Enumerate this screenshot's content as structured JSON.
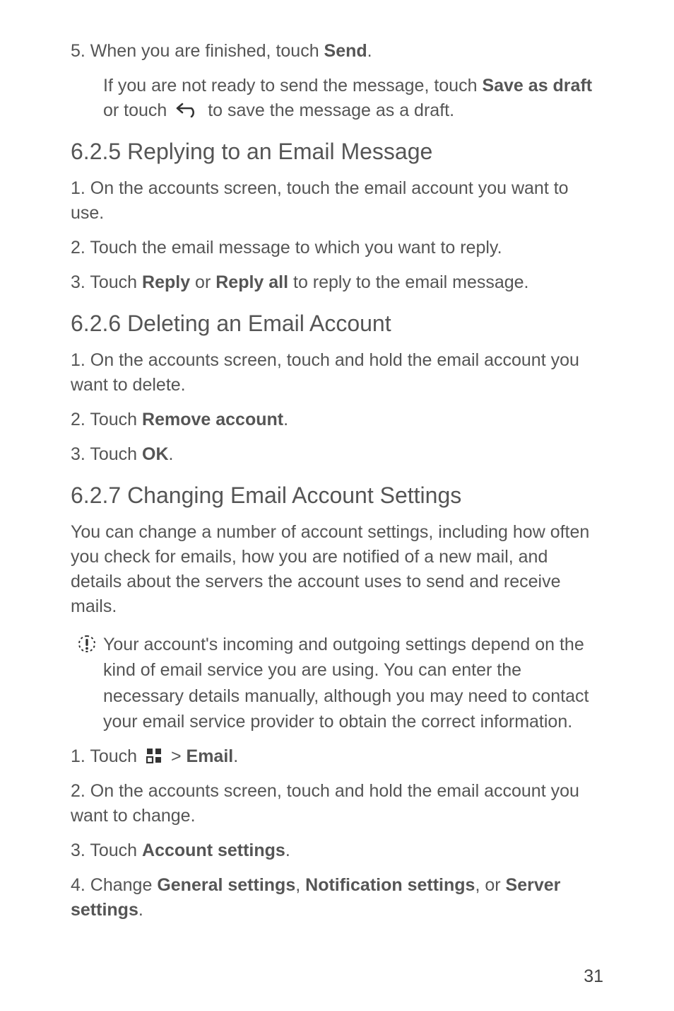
{
  "s0": {
    "step5_prefix": "5. When you are finished, touch ",
    "step5_bold": "Send",
    "step5_suffix": ".",
    "sub_prefix": "If you are not ready to send the message, touch ",
    "sub_bold": "Save as draft",
    "sub_mid": " or touch ",
    "sub_suffix": " to save the message as a draft."
  },
  "h1": "6.2.5  Replying to an Email Message",
  "s1": {
    "i1": "1. On the accounts screen, touch the email account you want to use.",
    "i2": "2. Touch the email message to which you want to reply.",
    "i3_prefix": "3. Touch ",
    "i3_b1": "Reply",
    "i3_mid": " or ",
    "i3_b2": "Reply all",
    "i3_suffix": " to reply to the email message."
  },
  "h2": "6.2.6  Deleting an Email Account",
  "s2": {
    "i1": "1. On the accounts screen, touch and hold the email account you want to delete.",
    "i2_prefix": "2. Touch ",
    "i2_bold": "Remove account",
    "i2_suffix": ".",
    "i3_prefix": "3. Touch ",
    "i3_bold": "OK",
    "i3_suffix": "."
  },
  "h3": "6.2.7  Changing Email Account Settings",
  "s3": {
    "intro": "You can change a number of account settings, including how often you check for emails, how you are notified of a new mail, and details about the servers the account uses to send and receive mails.",
    "note": "Your account's incoming and outgoing settings depend on the kind of email service you are using. You can enter the necessary details manually, although you may need to contact your email service provider to obtain the correct information.",
    "i1_prefix": "1. Touch ",
    "i1_mid": " > ",
    "i1_bold": "Email",
    "i1_suffix": ".",
    "i2": "2. On the accounts screen, touch and hold the email account you want to change.",
    "i3_prefix": "3. Touch ",
    "i3_bold": "Account settings",
    "i3_suffix": ".",
    "i4_prefix": "4. Change ",
    "i4_b1": "General settings",
    "i4_c1": ", ",
    "i4_b2": "Notification settings",
    "i4_c2": ", or ",
    "i4_b3": "Server settings",
    "i4_suffix": "."
  },
  "page_number": "31"
}
